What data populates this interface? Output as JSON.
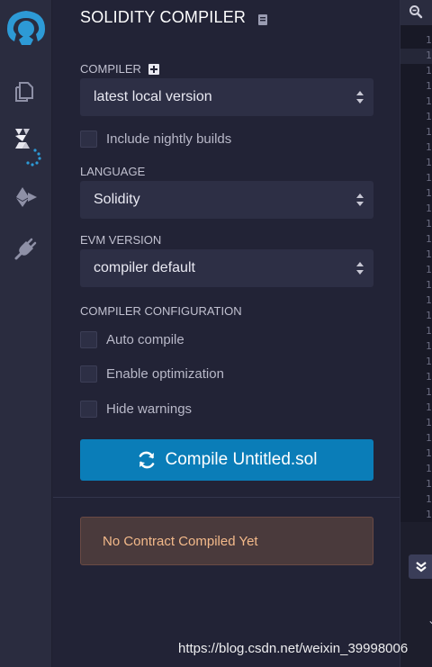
{
  "panel": {
    "title": "SOLIDITY COMPILER",
    "compiler_label": "COMPILER",
    "compiler_value": "latest local version",
    "nightly_label": "Include nightly builds",
    "language_label": "LANGUAGE",
    "language_value": "Solidity",
    "evm_label": "EVM VERSION",
    "evm_value": "compiler default",
    "config_label": "COMPILER CONFIGURATION",
    "auto_compile_label": "Auto compile",
    "optimization_label": "Enable optimization",
    "hide_warnings_label": "Hide warnings",
    "compile_button": "Compile Untitled.sol",
    "alert": "No Contract Compiled Yet"
  },
  "sidebar": {
    "icons": [
      "remix-logo-icon",
      "file-explorer-icon",
      "solidity-compiler-icon",
      "deploy-run-icon",
      "plugin-manager-icon"
    ]
  },
  "editor": {
    "line_numbers": [
      "1",
      "1",
      "1",
      "1",
      "1",
      "1",
      "1",
      "1",
      "1",
      "1",
      "1",
      "1",
      "1",
      "1",
      "1",
      "1",
      "1",
      "1",
      "1",
      "1",
      "1",
      "1",
      "1",
      "1",
      "1",
      "1",
      "1",
      "1",
      "1",
      "1",
      "1",
      "1"
    ]
  },
  "watermark": "https://blog.csdn.net/weixin_39998006",
  "colors": {
    "accent": "#0a7db8",
    "alert_text": "#f3b98a",
    "background": "#222336"
  }
}
